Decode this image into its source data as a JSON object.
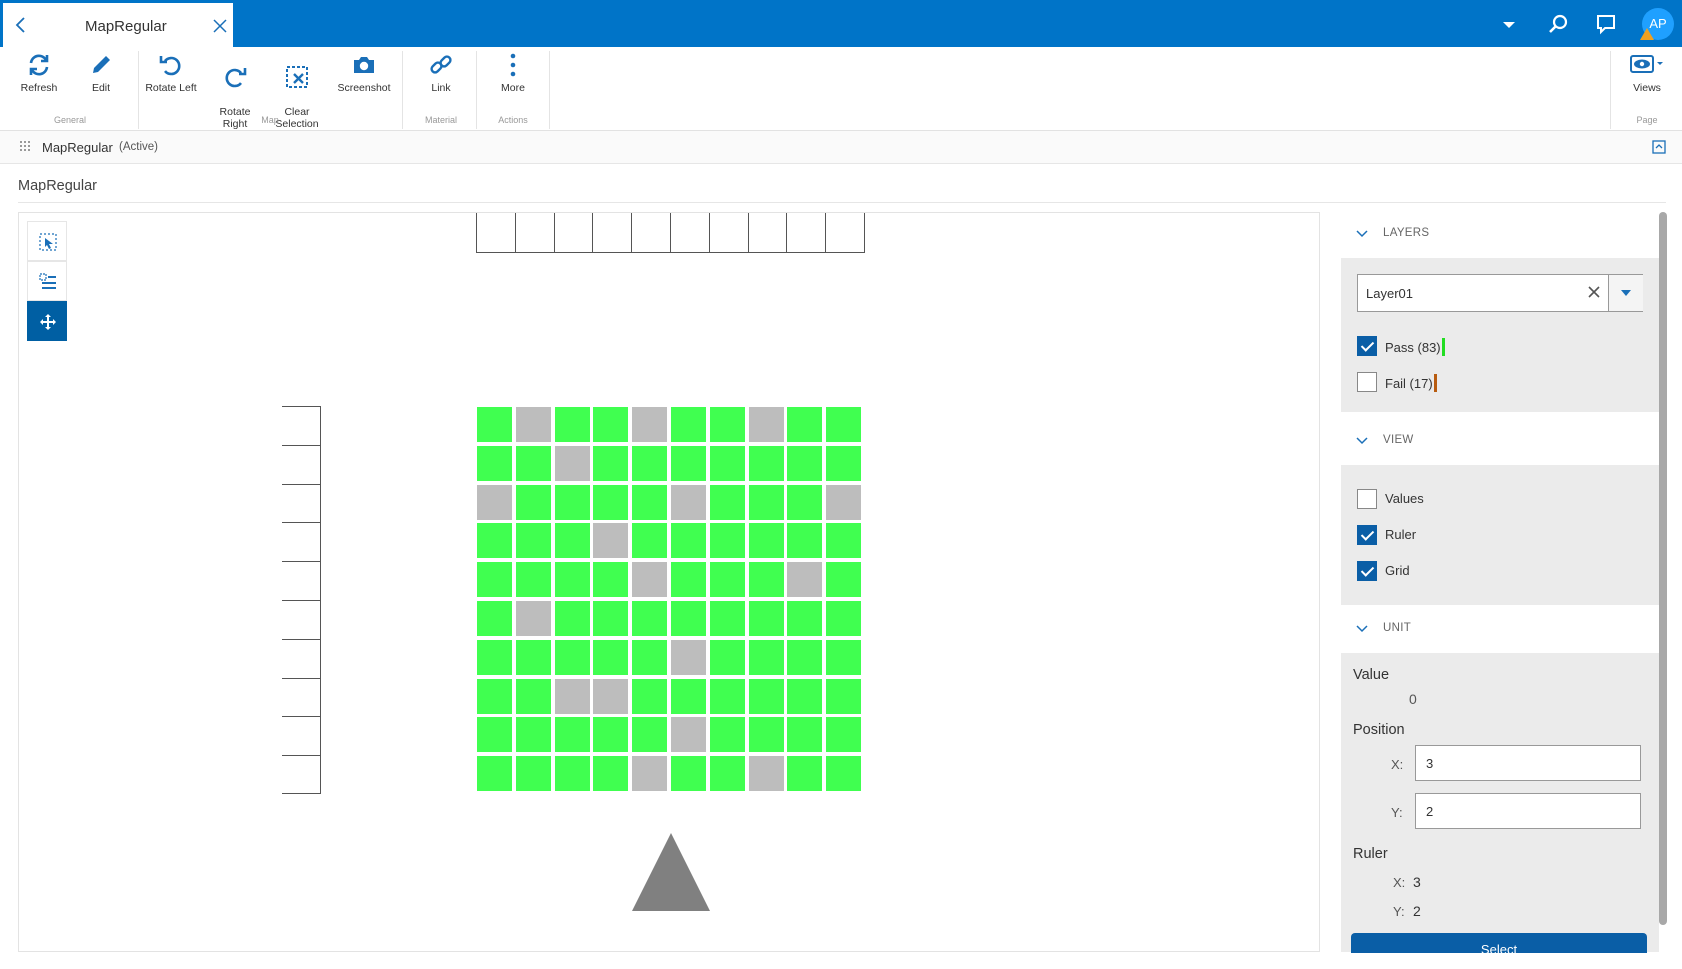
{
  "tab": {
    "title": "MapRegular"
  },
  "user": {
    "initials": "AP"
  },
  "ribbon": {
    "buttons": [
      {
        "label": "Refresh",
        "icon": "refresh-icon"
      },
      {
        "label": "Edit",
        "icon": "pencil-icon"
      },
      {
        "label": "Rotate Left",
        "icon": "rotate-left-icon"
      },
      {
        "label": "Rotate\nRight",
        "icon": "rotate-right-icon"
      },
      {
        "label": "Clear\nSelection",
        "icon": "clear-selection-icon"
      },
      {
        "label": "Screenshot",
        "icon": "camera-icon"
      },
      {
        "label": "Link",
        "icon": "link-icon"
      },
      {
        "label": "More",
        "icon": "more-vertical-icon"
      },
      {
        "label": "Views",
        "icon": "eye-icon"
      }
    ],
    "groups": [
      "General",
      "Map",
      "Material",
      "Actions",
      "Page"
    ]
  },
  "breadcrumb": {
    "name": "MapRegular",
    "status": "(Active)"
  },
  "page": {
    "title": "MapRegular"
  },
  "colors": {
    "header": "#0074c8",
    "pass": "#40ff50",
    "fail": "#bdbdbd",
    "accent": "#0a5ea6"
  },
  "map": {
    "rows": 10,
    "cols": 10,
    "grid": [
      "PFPPFPPFPP",
      "PPFPPPPPPP",
      "FPPPPFPPPF",
      "PPPFPPPPPP",
      "PPPPFPPPFP",
      "PFPPPPPPPP",
      "PPPPPFPPPP",
      "PPFFPPPPPP",
      "PPPPPFPPPP",
      "PPPPFPPFPP"
    ]
  },
  "panel": {
    "layers": {
      "heading": "LAYERS",
      "selected": "Layer01",
      "items": [
        {
          "label": "Pass (83)",
          "checked": true,
          "color": "#22dd22"
        },
        {
          "label": "Fail (17)",
          "checked": false,
          "color": "#b85c10"
        }
      ]
    },
    "view": {
      "heading": "VIEW",
      "items": [
        {
          "label": "Values",
          "checked": false
        },
        {
          "label": "Ruler",
          "checked": true
        },
        {
          "label": "Grid",
          "checked": true
        }
      ]
    },
    "unit": {
      "heading": "UNIT",
      "value_label": "Value",
      "value": "0",
      "position_label": "Position",
      "x_label": "X:",
      "y_label": "Y:",
      "pos_x": "3",
      "pos_y": "2",
      "ruler_label": "Ruler",
      "ruler_x": "3",
      "ruler_y": "2"
    },
    "select_button": "Select"
  }
}
